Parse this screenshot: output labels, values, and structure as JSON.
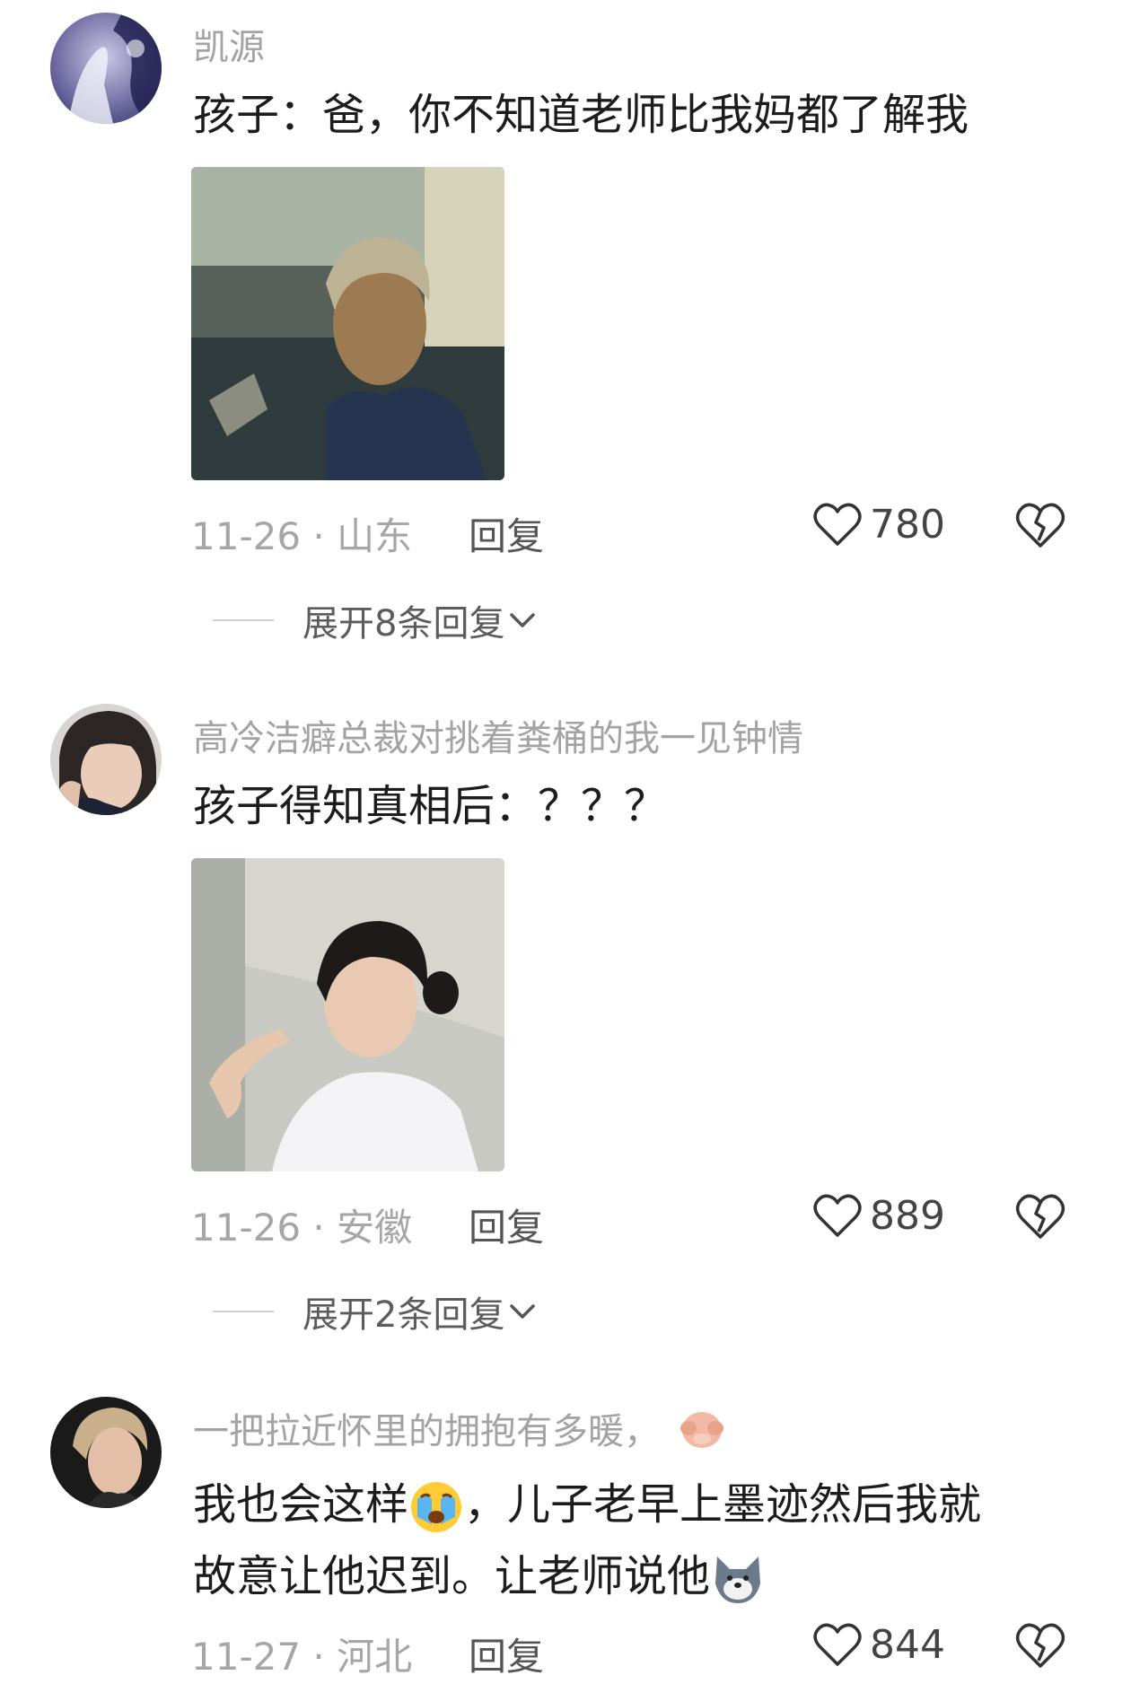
{
  "comments": [
    {
      "username": "凯源",
      "text": "孩子：爸，你不知道老师比我妈都了解我",
      "date_location": "11-26 · 山东",
      "reply_label": "回复",
      "likes": "780",
      "expand_label": "展开8条回复"
    },
    {
      "username": "高冷洁癖总裁对挑着粪桶的我一见钟情",
      "text": "孩子得知真相后：？？？",
      "date_location": "11-26 · 安徽",
      "reply_label": "回复",
      "likes": "889",
      "expand_label": "展开2条回复"
    },
    {
      "username": "一把拉近怀里的拥抱有多暖，",
      "text_line1_a": "我也会这样",
      "text_line1_b": "，儿子老早上墨迹然后我就",
      "text_line2": "故意让他迟到。让老师说他",
      "date_location": "11-27 · 河北",
      "reply_label": "回复",
      "likes": "844"
    }
  ],
  "icons": [
    "heart-icon",
    "broken-heart-icon",
    "chevron-down-icon",
    "crying-emoji-icon",
    "dog-emoji-icon",
    "see-no-evil-emoji-icon"
  ]
}
